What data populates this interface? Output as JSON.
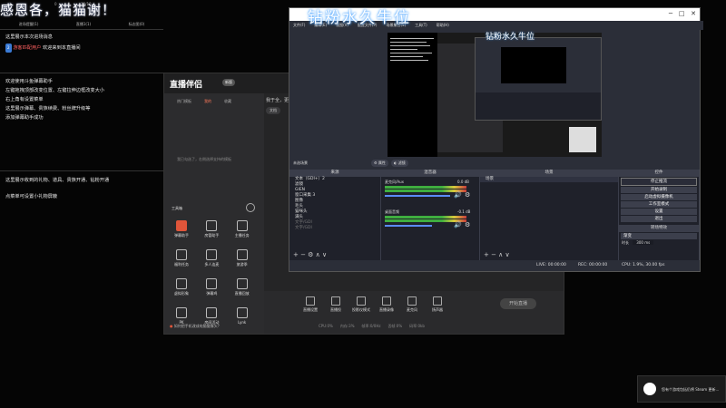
{
  "banner": {
    "text": "感恩各，猫猫谢！",
    "counts": [
      "0",
      "0",
      "19/12"
    ]
  },
  "helper": {
    "tabs": [
      "进场提醒",
      "直播1",
      "标志图"
    ],
    "tab_counts": [
      "(1)",
      "(1)",
      "(0)"
    ],
    "lines": [
      "这里展示本次进场消息",
      "欢迎使用斗鱼弹幕助手",
      "左键拖拽顶部改变位置、左键拉伸边框改变大小",
      "右上角有设置菜单",
      "这里展示弹幕、贵族续费、粉丝牌升级等",
      "添加弹幕助手成功"
    ],
    "welcome": {
      "badge": "2",
      "name": "游客匹配用户",
      "text": "欢迎来到本直播间"
    },
    "gift_lines": [
      "这里展示收到的礼物、道具、贵族开通、钻粉开通",
      "点菜单可设置小礼物屏蔽"
    ]
  },
  "zbbl": {
    "logo": "直播伴侣",
    "version": "新版",
    "tabs": [
      "热门模板",
      "我的",
      "收藏"
    ],
    "panel_hint": "我已勾选了，右侧选择支持的模板",
    "toolbox": "工具箱",
    "tools": [
      "弹幕助手",
      "房管助手",
      "主播任务",
      "福利任务",
      "多人连麦",
      "旅游季",
      "虚拟形象",
      "弹幕鸡",
      "直播回放",
      "PK",
      "房间活动",
      "Lynk"
    ],
    "preview_hint": "我于全，更多",
    "source_btn": "文档",
    "bottom": [
      "直播设置",
      "直播投",
      "投影仪模式",
      "直播录像",
      "麦克风",
      "扬声器"
    ],
    "start_live": "开始直播",
    "stats": [
      "CPU:0%",
      "内存:3%",
      "帧率:0/0Hz",
      "丢帧:0%",
      "码率:0kb"
    ],
    "hint": "如何把手机改成电脑摄像头？"
  },
  "obs": {
    "caption": "钻粉水久牛位",
    "window_controls": [
      "─",
      "□",
      "✕"
    ],
    "menu": [
      "文件(F)",
      "编辑(E)",
      "视图(V)",
      "配置文件(P)",
      "场景集合(S)",
      "工具(T)",
      "帮助(H)"
    ],
    "nested_caption": "钻粉水久牛位",
    "scene_name": "未选场景",
    "scene_toggles": [
      "属性",
      "滤镜"
    ],
    "docks": {
      "sources_title": "来源",
      "mixer_title": "混音器",
      "transitions_title": "场景",
      "controls_title": "控件"
    },
    "sources": [
      "文本（GDI+）2",
      "滤镜",
      "GIEN",
      "窗口采集 3",
      "图像",
      "毛头",
      "猫咪头",
      "满头",
      "文字/GDI",
      "文字/GDI"
    ],
    "mixer": [
      {
        "name": "麦克风/Aux",
        "db": "0.0 dB"
      },
      {
        "name": "桌面音频",
        "db": "-0.1 dB"
      }
    ],
    "transition": "场景",
    "controls": [
      "停止推流",
      "开始录制",
      "启动虚拟摄像机",
      "工作室模式",
      "设置",
      "退出"
    ],
    "transition_label": "转场特效",
    "fade": "渐变",
    "duration_label": "时长",
    "duration": "300 ms",
    "status": [
      "LIVE: 00:00:00",
      "REC: 00:00:00",
      "CPU: 1.9%, 30.00 fps"
    ]
  },
  "steam": {
    "text": "您有个游戏包括仍将 Steam 更新..."
  }
}
